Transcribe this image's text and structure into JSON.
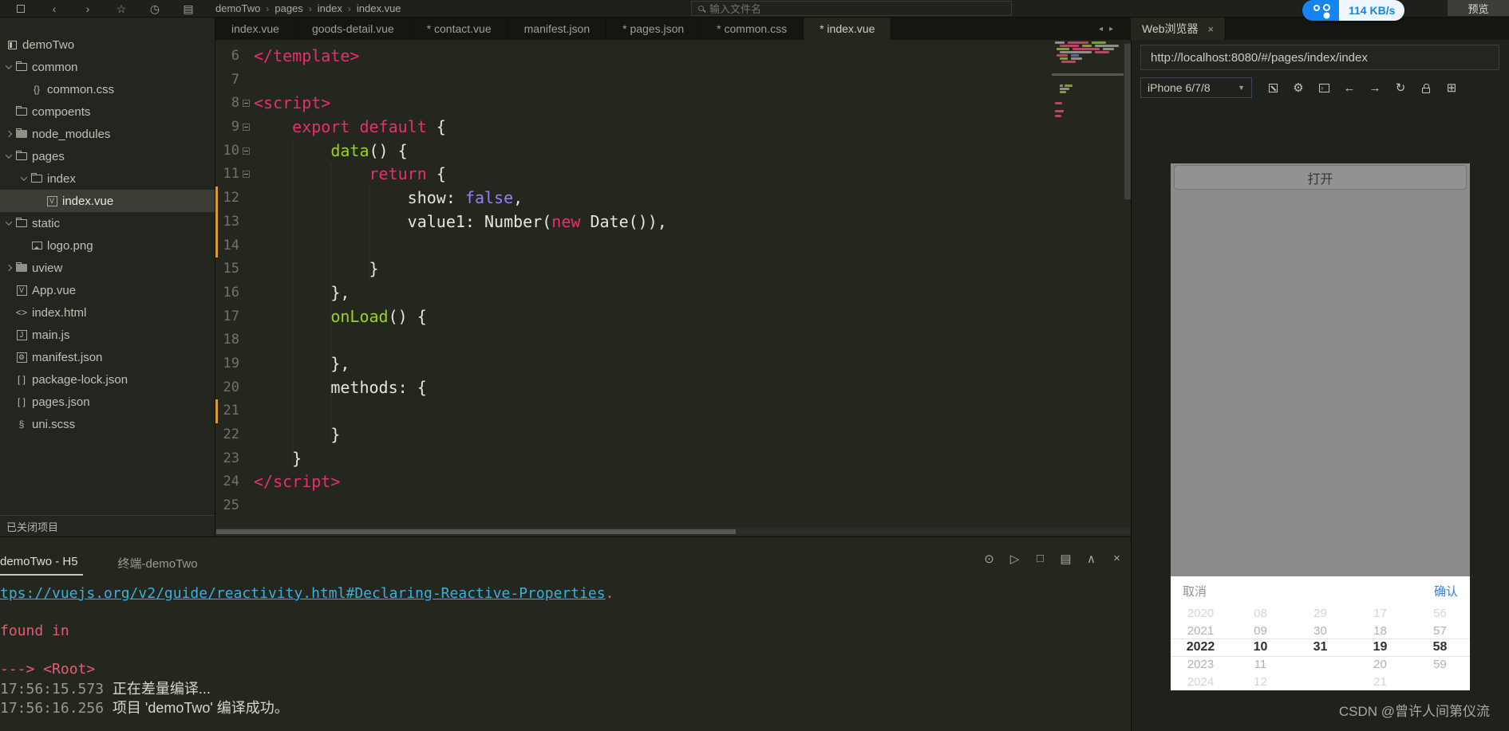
{
  "toolbar": {
    "breadcrumb": [
      "demoTwo",
      "pages",
      "index",
      "index.vue"
    ],
    "search_placeholder": "输入文件名",
    "speed_badge": "114 KB/s",
    "preview_button": "预览"
  },
  "editor_tabs": [
    {
      "label": "index.vue",
      "active": false
    },
    {
      "label": "goods-detail.vue",
      "active": false
    },
    {
      "label": "* contact.vue",
      "active": false
    },
    {
      "label": "manifest.json",
      "active": false
    },
    {
      "label": "* pages.json",
      "active": false
    },
    {
      "label": "* common.css",
      "active": false
    },
    {
      "label": "* index.vue",
      "active": true
    }
  ],
  "browser_tab": {
    "label": "Web浏览器"
  },
  "sidebar": {
    "items": [
      {
        "label": "demoTwo",
        "icon": "project",
        "indent": 0,
        "arrow": ""
      },
      {
        "label": "common",
        "icon": "folder",
        "indent": 0,
        "arrow": "down"
      },
      {
        "label": "common.css",
        "icon": "braces",
        "indent": 1,
        "arrow": ""
      },
      {
        "label": "compoents",
        "icon": "folder",
        "indent": 0,
        "arrow": ""
      },
      {
        "label": "node_modules",
        "icon": "folder-solid",
        "indent": 0,
        "arrow": "right"
      },
      {
        "label": "pages",
        "icon": "folder",
        "indent": 0,
        "arrow": "down"
      },
      {
        "label": "index",
        "icon": "folder",
        "indent": 1,
        "arrow": "down"
      },
      {
        "label": "index.vue",
        "icon": "vue",
        "indent": 2,
        "arrow": "",
        "selected": true
      },
      {
        "label": "static",
        "icon": "folder",
        "indent": 0,
        "arrow": "down"
      },
      {
        "label": "logo.png",
        "icon": "image",
        "indent": 1,
        "arrow": ""
      },
      {
        "label": "uview",
        "icon": "folder-solid",
        "indent": 0,
        "arrow": "right"
      },
      {
        "label": "App.vue",
        "icon": "vue",
        "indent": 0,
        "arrow": ""
      },
      {
        "label": "index.html",
        "icon": "html",
        "indent": 0,
        "arrow": ""
      },
      {
        "label": "main.js",
        "icon": "js",
        "indent": 0,
        "arrow": ""
      },
      {
        "label": "manifest.json",
        "icon": "json-gear",
        "indent": 0,
        "arrow": ""
      },
      {
        "label": "package-lock.json",
        "icon": "brackets",
        "indent": 0,
        "arrow": ""
      },
      {
        "label": "pages.json",
        "icon": "brackets",
        "indent": 0,
        "arrow": ""
      },
      {
        "label": "uni.scss",
        "icon": "scss",
        "indent": 0,
        "arrow": ""
      }
    ],
    "footer": "已关闭项目"
  },
  "editor": {
    "lines": [
      {
        "n": 6,
        "seg": [
          [
            "p",
            "</template>"
          ]
        ]
      },
      {
        "n": 7,
        "seg": []
      },
      {
        "n": 8,
        "fold": true,
        "seg": [
          [
            "p",
            "<script>"
          ]
        ]
      },
      {
        "n": 9,
        "fold": true,
        "seg": [
          [
            "w",
            "    "
          ],
          [
            "p",
            "export default"
          ],
          [
            "w",
            " {"
          ]
        ]
      },
      {
        "n": 10,
        "fold": true,
        "seg": [
          [
            "w",
            "        "
          ],
          [
            "g",
            "data"
          ],
          [
            "w",
            "() {"
          ]
        ]
      },
      {
        "n": 11,
        "fold": true,
        "seg": [
          [
            "w",
            "            "
          ],
          [
            "p",
            "return"
          ],
          [
            "w",
            " {"
          ]
        ]
      },
      {
        "n": 12,
        "changed": true,
        "seg": [
          [
            "w",
            "                show: "
          ],
          [
            "v",
            "false"
          ],
          [
            "w",
            ","
          ]
        ]
      },
      {
        "n": 13,
        "changed": true,
        "seg": [
          [
            "w",
            "                value1: Number("
          ],
          [
            "p",
            "new"
          ],
          [
            "w",
            " Date()),"
          ]
        ]
      },
      {
        "n": 14,
        "changed": true,
        "seg": []
      },
      {
        "n": 15,
        "seg": [
          [
            "w",
            "            }"
          ]
        ]
      },
      {
        "n": 16,
        "seg": [
          [
            "w",
            "        },"
          ]
        ]
      },
      {
        "n": 17,
        "seg": [
          [
            "w",
            "        "
          ],
          [
            "g",
            "onLoad"
          ],
          [
            "w",
            "() {"
          ]
        ]
      },
      {
        "n": 18,
        "seg": []
      },
      {
        "n": 19,
        "seg": [
          [
            "w",
            "        },"
          ]
        ]
      },
      {
        "n": 20,
        "seg": [
          [
            "w",
            "        methods: {"
          ]
        ]
      },
      {
        "n": 21,
        "changed": true,
        "seg": []
      },
      {
        "n": 22,
        "seg": [
          [
            "w",
            "        }"
          ]
        ]
      },
      {
        "n": 23,
        "seg": [
          [
            "w",
            "    }"
          ]
        ]
      },
      {
        "n": 24,
        "seg": [
          [
            "p",
            "</script>"
          ]
        ]
      },
      {
        "n": 25,
        "seg": []
      }
    ]
  },
  "console": {
    "tabs": [
      {
        "label": "demoTwo - H5",
        "active": true
      },
      {
        "label": "终端-demoTwo",
        "active": false
      }
    ],
    "lines": [
      {
        "type": "link",
        "text": "tps://vuejs.org/v2/guide/reactivity.html#Declaring-Reactive-Properties",
        "suffix": "."
      },
      {
        "type": "error",
        "text": "found in"
      },
      {
        "type": "error",
        "text": "---> <Root>"
      },
      {
        "type": "log",
        "time": "17:56:15.573",
        "text": "正在差量编译..."
      },
      {
        "type": "log",
        "time": "17:56:16.256",
        "text": "项目 'demoTwo' 编译成功。"
      }
    ]
  },
  "browser": {
    "url": "http://localhost:8080/#/pages/index/index",
    "device": "iPhone 6/7/8",
    "phone": {
      "open_button": "打开",
      "picker": {
        "cancel": "取消",
        "confirm": "确认",
        "columns": [
          [
            "2020",
            "2021",
            "2022",
            "2023",
            "2024"
          ],
          [
            "08",
            "09",
            "10",
            "11",
            "12"
          ],
          [
            "29",
            "30",
            "31",
            "",
            ""
          ],
          [
            "17",
            "18",
            "19",
            "20",
            "21"
          ],
          [
            "56",
            "57",
            "58",
            "59",
            ""
          ]
        ],
        "selected_row": 2
      }
    }
  },
  "watermark": "CSDN @曾许人间第仪流",
  "colors": {
    "accent_blue": "#1583f0",
    "keyword_pink": "#ea2e6d",
    "function_green": "#9fd411",
    "literal_purple": "#9d7df2",
    "link_cyan": "#3eaede",
    "error_pink": "#e45c72",
    "change_orange": "#dc9a33",
    "picker_confirm_blue": "#2f7fe8"
  }
}
